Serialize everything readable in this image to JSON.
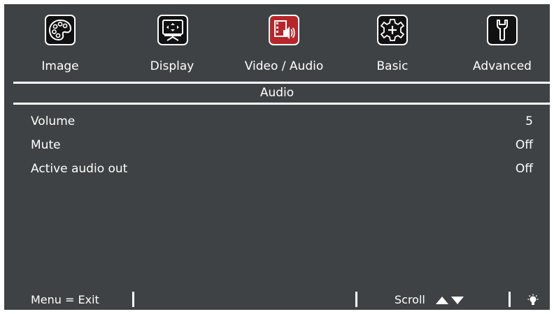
{
  "tabs": [
    {
      "label": "Image",
      "icon": "palette-icon",
      "active": false
    },
    {
      "label": "Display",
      "icon": "projector-screen-icon",
      "active": false
    },
    {
      "label": "Video / Audio",
      "icon": "film-speaker-icon",
      "active": true
    },
    {
      "label": "Basic",
      "icon": "gear-icon",
      "active": false
    },
    {
      "label": "Advanced",
      "icon": "wrench-icon",
      "active": false
    }
  ],
  "section": {
    "title": "Audio"
  },
  "rows": [
    {
      "label": "Volume",
      "value": "5"
    },
    {
      "label": "Mute",
      "value": "Off"
    },
    {
      "label": "Active audio out",
      "value": "Off"
    }
  ],
  "footer": {
    "exit_label": "Menu = Exit",
    "scroll_label": "Scroll",
    "arrows_icon": "up-down-arrows-icon",
    "hint_icon": "lightbulb-icon"
  },
  "colors": {
    "background": "#3f4244",
    "active_tab": "#b8262a",
    "text": "#ffffff"
  }
}
